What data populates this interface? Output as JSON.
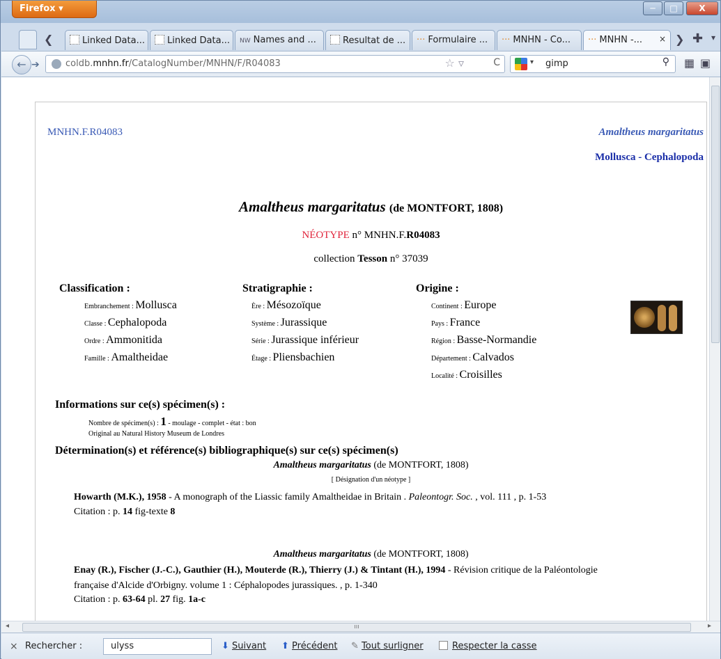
{
  "browser": {
    "app_button": "Firefox",
    "window_controls": {
      "minimize": "─",
      "maximize": "□",
      "close": "X"
    },
    "tabs": [
      {
        "label": "Linked Data..."
      },
      {
        "label": "Linked Data..."
      },
      {
        "label": "Names and ..."
      },
      {
        "label": "Resultat de ..."
      },
      {
        "label": "Formulaire ..."
      },
      {
        "label": "MNHN - Co..."
      },
      {
        "label": "MNHN -...",
        "active": true
      }
    ],
    "tab_close": "×",
    "url": {
      "prefix": "coldb.",
      "domain": "mnhn.fr",
      "path": "/CatalogNumber/MNHN/F/R04083"
    },
    "search_query": "gimp"
  },
  "record": {
    "catalog_id": "MNHN.F.R04083",
    "taxon_header": "Amaltheus margaritatus",
    "group": "Mollusca - Cephalopoda",
    "title_taxon": "Amaltheus margaritatus",
    "title_author": "(de MONTFORT, 1808)",
    "type_status": "NÉOTYPE",
    "type_num_prefix": "n° MNHN.F.",
    "type_num_bold": "R04083",
    "collection_prefix": "collection ",
    "collection_name": "Tesson",
    "collection_num": " n° 37039"
  },
  "classification": {
    "heading": "Classification :",
    "rows": [
      {
        "key": "Embranchement : ",
        "value": "Mollusca"
      },
      {
        "key": "Classe : ",
        "value": "Cephalopoda"
      },
      {
        "key": "Ordre : ",
        "value": "Ammonitida"
      },
      {
        "key": "Famille : ",
        "value": "Amaltheidae"
      }
    ]
  },
  "stratigraphy": {
    "heading": "Stratigraphie :",
    "rows": [
      {
        "key": "Ère : ",
        "value": "Mésozoïque"
      },
      {
        "key": "Système : ",
        "value": "Jurassique"
      },
      {
        "key": "Série : ",
        "value": "Jurassique inférieur"
      },
      {
        "key": "Étage : ",
        "value": "Pliensbachien"
      }
    ]
  },
  "origin": {
    "heading": "Origine :",
    "rows": [
      {
        "key": "Continent : ",
        "value": "Europe"
      },
      {
        "key": "Pays : ",
        "value": "France"
      },
      {
        "key": "Région : ",
        "value": "Basse-Normandie"
      },
      {
        "key": "Département : ",
        "value": "Calvados"
      },
      {
        "key": "Localité : ",
        "value": "Croisilles"
      }
    ]
  },
  "specimens": {
    "heading": "Informations sur ce(s) spécimen(s) :",
    "count_label": "Nombre de spécimen(s) : ",
    "count": "1",
    "count_detail": " - moulage - complet - état : bon",
    "original": "Original au Natural History Museum de Londres"
  },
  "determinations": {
    "heading": "Détermination(s) et référence(s) bibliographique(s) sur ce(s) spécimen(s)",
    "entries": [
      {
        "taxon": "Amaltheus margaritatus",
        "author": " (de MONTFORT, 1808)",
        "designation": "[ Désignation d'un néotype ]",
        "ref_authors": "Howarth (M.K.), 1958",
        "ref_title": " - A monograph of the Liassic family Amaltheidae in Britain . ",
        "ref_journal": "Paleontogr. Soc.",
        "ref_tail": " , vol. 111 , p. 1-53",
        "cit_prefix": "Citation : p. ",
        "cit_page": "14",
        "cit_mid": " fig-texte ",
        "cit_fig": "8"
      },
      {
        "taxon": "Amaltheus margaritatus",
        "author": " (de MONTFORT, 1808)",
        "ref_authors": "Enay (R.), Fischer (J.-C.), Gauthier (H.), Mouterde (R.), Thierry (J.) & Tintant (H.), 1994",
        "ref_title": " - Révision critique de la Paléontologie",
        "ref_line2": "française d'Alcide d'Orbigny. volume 1 : Céphalopodes jurassiques. , p. 1-340",
        "cit_prefix": "Citation : p. ",
        "cit_page": "63-64",
        "cit_mid": " pl. ",
        "cit_pl": "27",
        "cit_fig_label": " fig. ",
        "cit_fig": "1a-c"
      }
    ]
  },
  "findbar": {
    "label": "Rechercher :",
    "value": "ulyss",
    "next": "Suivant",
    "prev": "Précédent",
    "highlight": "Tout surligner",
    "match_case": "Respecter la casse"
  }
}
